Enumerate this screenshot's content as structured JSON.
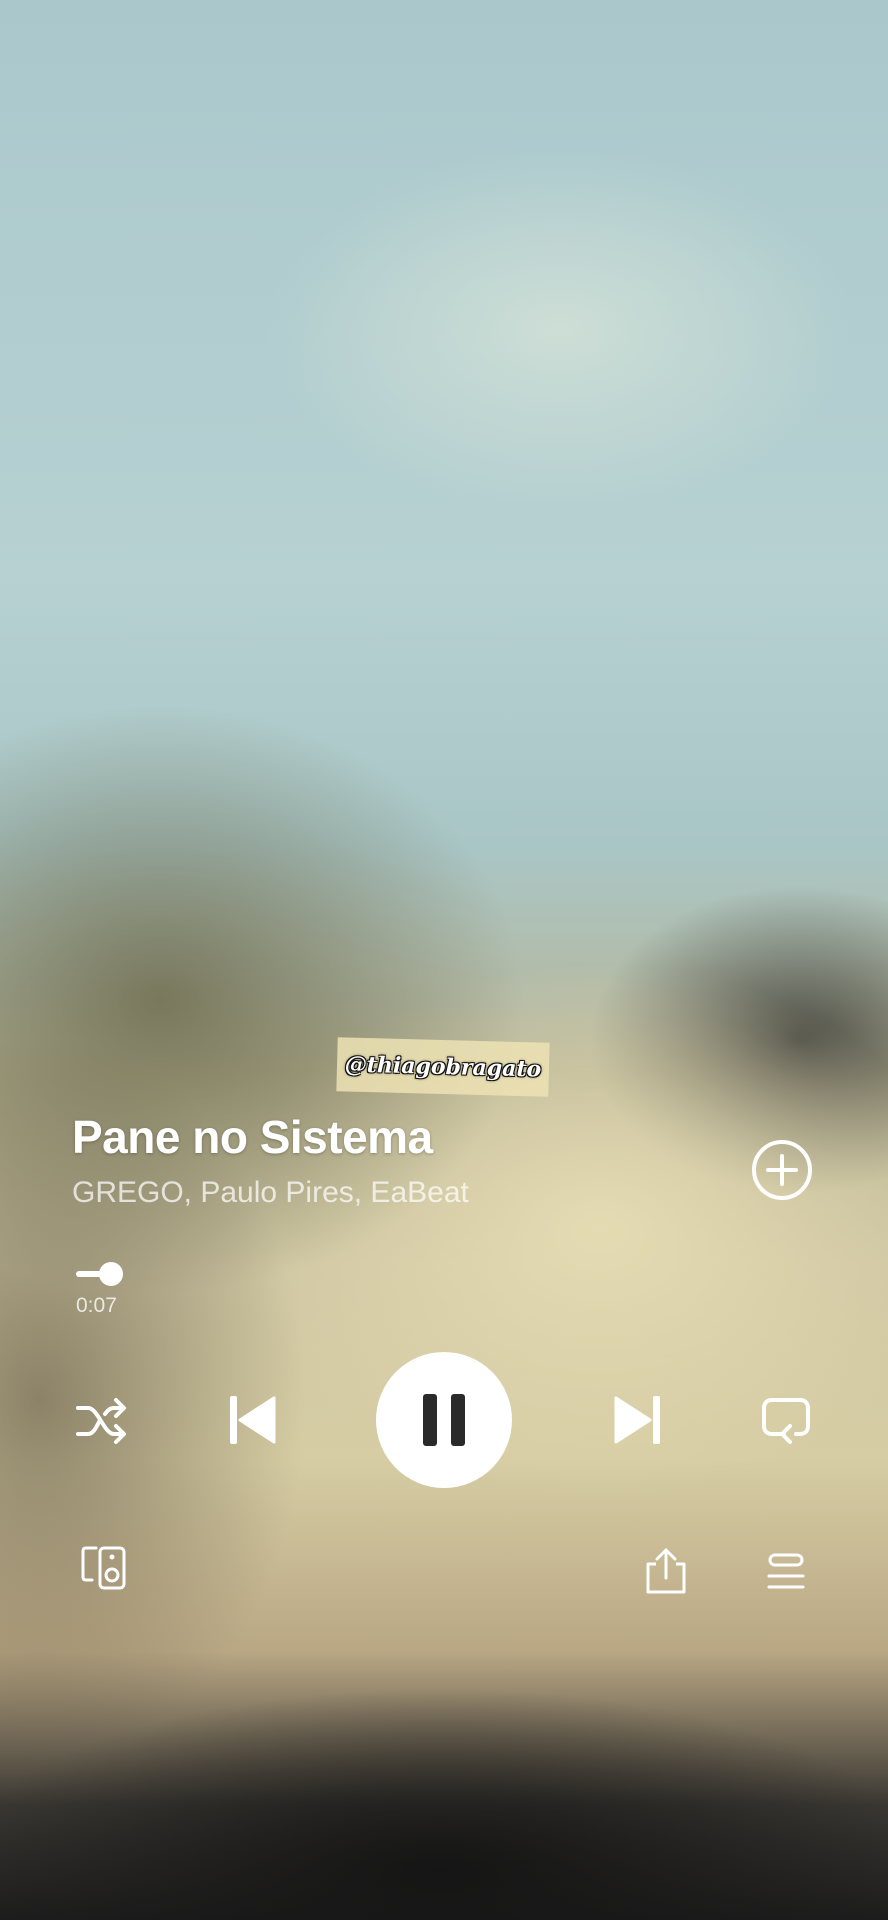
{
  "track": {
    "title": "Pane no Sistema",
    "artists": "GREGO, Paulo Pires, EaBeat"
  },
  "watermark": "@thiagobragato",
  "progress": {
    "elapsed": "0:07",
    "fraction": 0.03
  },
  "controls": {
    "shuffle_icon": "shuffle-icon",
    "previous_icon": "skip-previous-icon",
    "play_state_icon": "pause-icon",
    "next_icon": "skip-next-icon",
    "repeat_icon": "repeat-icon",
    "add_icon": "plus-circle-icon",
    "device_icon": "connect-device-icon",
    "share_icon": "share-icon",
    "queue_icon": "queue-icon"
  },
  "colors": {
    "foreground": "#ffffff",
    "pause_glyph": "#2a2a2a"
  }
}
